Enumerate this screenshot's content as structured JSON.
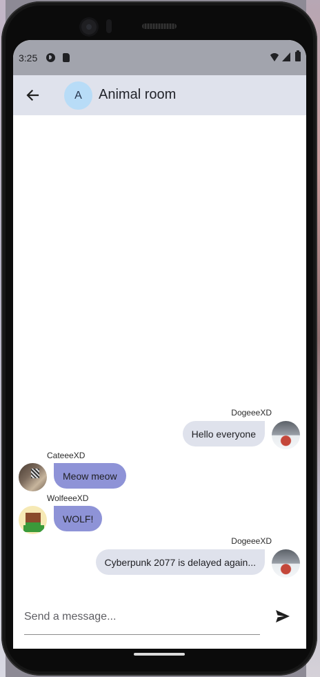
{
  "status_bar": {
    "time": "3:25",
    "icons": [
      "app-notification-icon",
      "sd-card-icon",
      "wifi-icon",
      "signal-icon",
      "battery-icon"
    ]
  },
  "app_bar": {
    "back_icon": "arrow-back-icon",
    "avatar_letter": "A",
    "title": "Animal room"
  },
  "messages": [
    {
      "sender": "DogeeeXD",
      "text": "Hello everyone",
      "direction": "outgoing",
      "avatar": "dog-avatar"
    },
    {
      "sender": "CateeeXD",
      "text": "Meow meow",
      "direction": "incoming",
      "avatar": "cat-avatar"
    },
    {
      "sender": "WolfeeeXD",
      "text": "WOLF!",
      "direction": "incoming",
      "avatar": "wolf-avatar"
    },
    {
      "sender": "DogeeeXD",
      "text": "Cyberpunk 2077 is delayed again...",
      "direction": "outgoing",
      "avatar": "dog-avatar"
    }
  ],
  "composer": {
    "placeholder": "Send a message...",
    "value": "",
    "send_icon": "send-icon"
  },
  "colors": {
    "app_bar": "#dfe2ec",
    "outgoing_bubble": "#dfe2ec",
    "incoming_bubble": "#8e93d7",
    "room_avatar": "#b8dcf7",
    "status_bar": "#a2a4ad"
  }
}
